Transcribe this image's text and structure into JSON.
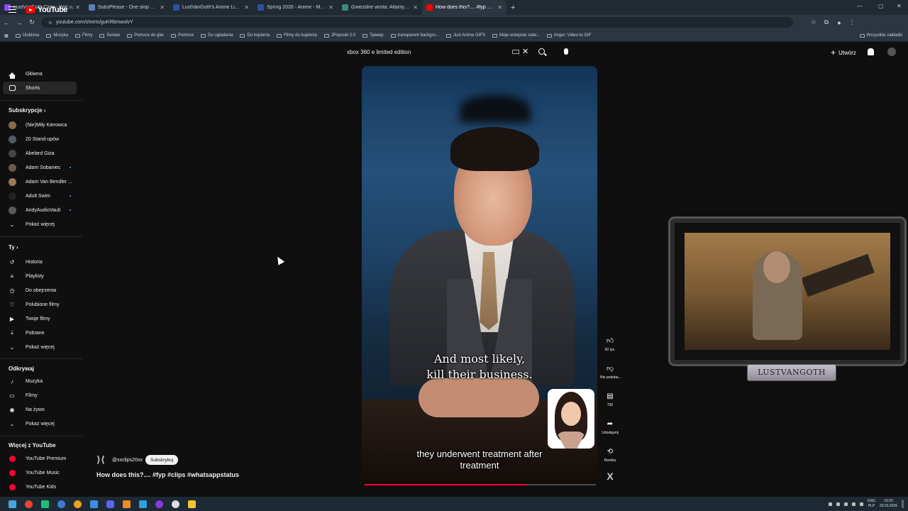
{
  "browser": {
    "tabs": [
      {
        "title": "LustVanGoth Clips - Watch Live",
        "color": "#9146ff"
      },
      {
        "title": "SubsPlease - One stop shop fo...",
        "color": "#5a7fc0"
      },
      {
        "title": "LustVanGoth's Anime List - My...",
        "color": "#2e51a2"
      },
      {
        "title": "Spring 2026 - Anime - MyAnim...",
        "color": "#2e51a2"
      },
      {
        "title": "Gwiezdne wrota: Atlantyda / St...",
        "color": "#3a8a7a"
      },
      {
        "title": "How does this?.... #fyp #clip...",
        "color": "#ff0000",
        "active": true
      }
    ],
    "new_tab_label": "+",
    "url": "youtube.com/shorts/guKRbmwolvY",
    "bookmarks": [
      "Ulubiona",
      "Muzyka",
      "Filmy",
      "Seriale",
      "Pomoce do gier",
      "Pomoce",
      "Do ogladania",
      "Do kupienia",
      "Filmy do kupienia",
      "JPopsuki 2.0",
      "Трекер",
      "transparent backgro...",
      "Just Anime GIFS",
      "Moje wstepnie zatw...",
      "Imgur: Video to GIF"
    ],
    "bookmarks_right": "Wszystkie zakładki"
  },
  "youtube": {
    "logo_text": "YouTube",
    "logo_country": "PL",
    "search_value": "xbox 360 e limited edition",
    "create_label": "Utwórz",
    "sidebar": {
      "main": [
        {
          "label": "Główna",
          "icon": "home-icon"
        },
        {
          "label": "Shorts",
          "icon": "shorts-icon",
          "active": true
        }
      ],
      "subs_heading": "Subskrypcje",
      "subscriptions": [
        {
          "label": "(Nie)Miły Kierowca",
          "color": "#8a6a4a",
          "live": false
        },
        {
          "label": "20 Stand-upów",
          "color": "#555b66",
          "live": false
        },
        {
          "label": "Abelard Giza",
          "color": "#444",
          "live": false
        },
        {
          "label": "Adam Sobaniec",
          "color": "#6a5a50",
          "live": true
        },
        {
          "label": "Adam Van Bendler ...",
          "color": "#9a7a5a",
          "live": false
        },
        {
          "label": "Adult Swim",
          "color": "#222",
          "live": true
        },
        {
          "label": "AndyAudioVault",
          "color": "#5a5a5a",
          "live": true
        }
      ],
      "show_more": "Pokaż więcej",
      "you_heading": "Ty",
      "you_items": [
        {
          "label": "Historia",
          "icon": "history-icon"
        },
        {
          "label": "Playlisty",
          "icon": "playlists-icon"
        },
        {
          "label": "Do obejrzenia",
          "icon": "watch-later-icon"
        },
        {
          "label": "Polubione filmy",
          "icon": "liked-icon"
        },
        {
          "label": "Twoje filmy",
          "icon": "your-videos-icon"
        },
        {
          "label": "Pobrane",
          "icon": "downloads-icon"
        }
      ],
      "explore_heading": "Odkrywaj",
      "explore_items": [
        {
          "label": "Muzyka",
          "icon": "music-icon"
        },
        {
          "label": "Filmy",
          "icon": "movies-icon"
        },
        {
          "label": "Na żywo",
          "icon": "live-icon"
        }
      ],
      "more_heading": "Więcej z YouTube",
      "more_items": [
        {
          "label": "YouTube Premium"
        },
        {
          "label": "YouTube Music"
        },
        {
          "label": "YouTube Kids"
        }
      ]
    },
    "short": {
      "caption_top_line1": "And most likely,",
      "caption_top_line2": "kill their business.",
      "caption_bottom_line1": "they underwent treatment after",
      "caption_bottom_line2": "treatment",
      "progress_percent": 70,
      "channel": "@xxclips20xx",
      "subscribe_label": "Subskrybuj",
      "title": "How does this?.... #fyp #clips #whatsappstatus"
    },
    "actions": {
      "likes": "50 tys.",
      "dislike_label": "Nie podoba...",
      "comments": "792",
      "share_label": "Udostępnij",
      "remix_label": "Remiks"
    }
  },
  "overlay": {
    "streamer_name": "LUSTVANGOTH"
  },
  "taskbar": {
    "lang": "ENG",
    "lang2": "PLP",
    "time": "19:20",
    "date": "20.03.2026"
  }
}
